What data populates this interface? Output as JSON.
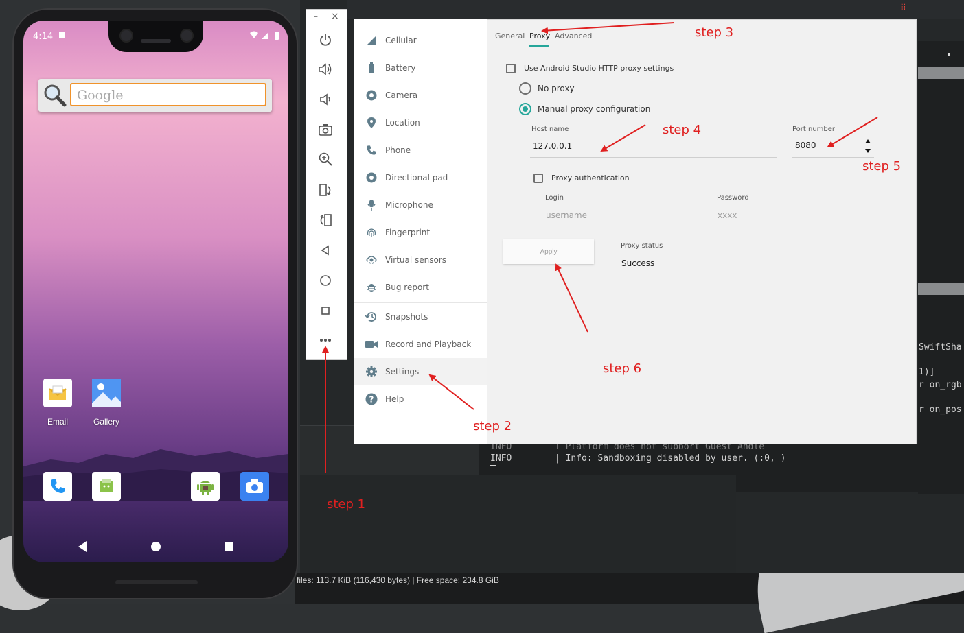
{
  "phone": {
    "status_time": "4:14",
    "search_widget_placeholder": "Google",
    "apps": [
      {
        "label": "Email",
        "icon": "email-icon"
      },
      {
        "label": "Gallery",
        "icon": "gallery-icon"
      }
    ],
    "dock": [
      "phone-icon",
      "messaging-icon",
      "android-icon",
      "camera-icon"
    ]
  },
  "toolbar": {
    "minimize": "–",
    "close": "×",
    "buttons": [
      "power-icon",
      "volume-up-icon",
      "volume-down-icon",
      "screenshot-icon",
      "zoom-icon",
      "rotate-left-icon",
      "rotate-right-icon",
      "back-icon",
      "home-icon",
      "overview-icon",
      "more-icon"
    ]
  },
  "sidebar": {
    "items": [
      {
        "label": "Cellular",
        "icon": "cellular-icon"
      },
      {
        "label": "Battery",
        "icon": "battery-icon"
      },
      {
        "label": "Camera",
        "icon": "camera-icon"
      },
      {
        "label": "Location",
        "icon": "location-icon"
      },
      {
        "label": "Phone",
        "icon": "phone-icon"
      },
      {
        "label": "Directional pad",
        "icon": "dpad-icon"
      },
      {
        "label": "Microphone",
        "icon": "microphone-icon"
      },
      {
        "label": "Fingerprint",
        "icon": "fingerprint-icon"
      },
      {
        "label": "Virtual sensors",
        "icon": "sensors-icon"
      },
      {
        "label": "Bug report",
        "icon": "bug-icon"
      },
      {
        "label": "Snapshots",
        "icon": "history-icon"
      },
      {
        "label": "Record and Playback",
        "icon": "video-icon"
      },
      {
        "label": "Settings",
        "icon": "gear-icon"
      },
      {
        "label": "Help",
        "icon": "help-icon"
      }
    ],
    "active": "Settings"
  },
  "tabs": {
    "general": "General",
    "proxy": "Proxy",
    "advanced": "Advanced",
    "active": "Proxy"
  },
  "proxy": {
    "use_studio_label": "Use Android Studio HTTP proxy settings",
    "use_studio_checked": false,
    "no_proxy_label": "No proxy",
    "manual_label": "Manual proxy configuration",
    "selected": "manual",
    "host_label": "Host name",
    "host_value": "127.0.0.1",
    "port_label": "Port number",
    "port_value": "8080",
    "auth_label": "Proxy authentication",
    "auth_checked": false,
    "login_label": "Login",
    "login_placeholder": "username",
    "password_label": "Password",
    "password_placeholder": "xxxx",
    "apply_label": "Apply",
    "status_label": "Proxy status",
    "status_value": "Success"
  },
  "terminal": {
    "right_lines": [
      "SwiftSha",
      "1)]",
      "r on_rgb",
      "r on_pos"
    ],
    "log_partial": "INFO        | Platform does not support Guest Angle",
    "log_line": "INFO        | Info: Sandboxing disabled by user. (:0, )",
    "status_bar": "files: 113.7 KiB (116,430 bytes)  |  Free space: 234.8 GiB"
  },
  "annotations": {
    "step1": "step 1",
    "step2": "step 2",
    "step3": "step 3",
    "step4": "step 4",
    "step5": "step 5",
    "step6": "step 6",
    "color": "#e02020"
  },
  "colors": {
    "accent": "#26a69a",
    "annotation": "#e02020"
  }
}
